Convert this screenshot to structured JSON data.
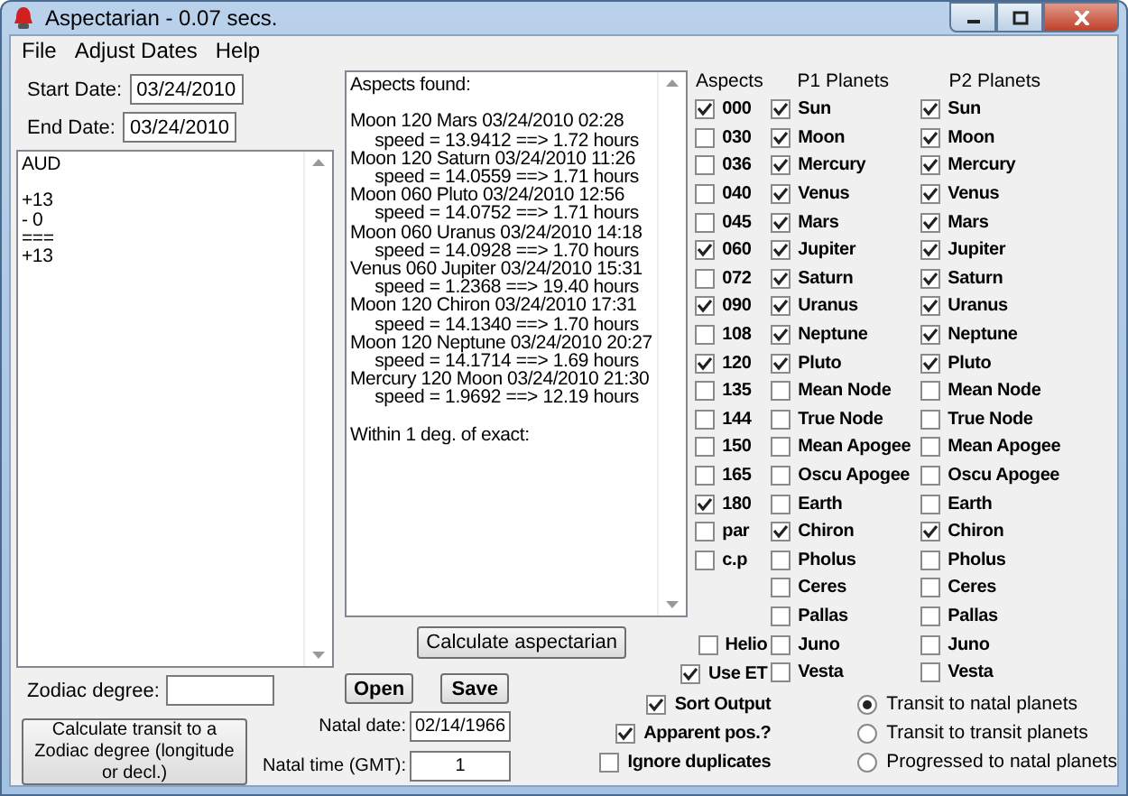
{
  "window": {
    "title": "Aspectarian - 0.07 secs."
  },
  "menu": [
    "File",
    "Adjust Dates",
    "Help"
  ],
  "start_date": {
    "label": "Start Date:",
    "value": "03/24/2010"
  },
  "end_date": {
    "label": "End Date:",
    "value": "03/24/2010"
  },
  "notes": "AUD\n\n+13\n- 0\n===\n+13",
  "zodiac_degree": {
    "label": "Zodiac degree:"
  },
  "zodiac_button": "Calculate transit to a Zodiac degree (longitude or decl.)",
  "output": "Aspects found:\n\nMoon 120 Mars 03/24/2010 02:28\n     speed = 13.9412 ==> 1.72 hours\nMoon 120 Saturn 03/24/2010 11:26\n     speed = 14.0559 ==> 1.71 hours\nMoon 060 Pluto 03/24/2010 12:56\n     speed = 14.0752 ==> 1.71 hours\nMoon 060 Uranus 03/24/2010 14:18\n     speed = 14.0928 ==> 1.70 hours\nVenus 060 Jupiter 03/24/2010 15:31\n     speed = 1.2368 ==> 19.40 hours\nMoon 120 Chiron 03/24/2010 17:31\n     speed = 14.1340 ==> 1.70 hours\nMoon 120 Neptune 03/24/2010 20:27\n     speed = 14.1714 ==> 1.69 hours\nMercury 120 Moon 03/24/2010 21:30\n     speed = 1.9692 ==> 12.19 hours\n\nWithin 1 deg. of exact:",
  "calculate_button": "Calculate aspectarian",
  "open_button": "Open",
  "save_button": "Save",
  "natal_date": {
    "label": "Natal date:",
    "value": "02/14/1966"
  },
  "natal_time": {
    "label": "Natal time (GMT):",
    "value": "1"
  },
  "headers": [
    "Aspects",
    "P1 Planets",
    "P2 Planets"
  ],
  "aspects": [
    {
      "label": "000",
      "checked": true
    },
    {
      "label": "030",
      "checked": false
    },
    {
      "label": "036",
      "checked": false
    },
    {
      "label": "040",
      "checked": false
    },
    {
      "label": "045",
      "checked": false
    },
    {
      "label": "060",
      "checked": true
    },
    {
      "label": "072",
      "checked": false
    },
    {
      "label": "090",
      "checked": true
    },
    {
      "label": "108",
      "checked": false
    },
    {
      "label": "120",
      "checked": true
    },
    {
      "label": "135",
      "checked": false
    },
    {
      "label": "144",
      "checked": false
    },
    {
      "label": "150",
      "checked": false
    },
    {
      "label": "165",
      "checked": false
    },
    {
      "label": "180",
      "checked": true
    },
    {
      "label": "par",
      "checked": false
    },
    {
      "label": "c.p",
      "checked": false
    }
  ],
  "p1_planets": [
    {
      "label": "Sun",
      "checked": true
    },
    {
      "label": "Moon",
      "checked": true
    },
    {
      "label": "Mercury",
      "checked": true
    },
    {
      "label": "Venus",
      "checked": true
    },
    {
      "label": "Mars",
      "checked": true
    },
    {
      "label": "Jupiter",
      "checked": true
    },
    {
      "label": "Saturn",
      "checked": true
    },
    {
      "label": "Uranus",
      "checked": true
    },
    {
      "label": "Neptune",
      "checked": true
    },
    {
      "label": "Pluto",
      "checked": true
    },
    {
      "label": "Mean Node",
      "checked": false
    },
    {
      "label": "True Node",
      "checked": false
    },
    {
      "label": "Mean Apogee",
      "checked": false
    },
    {
      "label": "Oscu Apogee",
      "checked": false
    },
    {
      "label": "Earth",
      "checked": false
    },
    {
      "label": "Chiron",
      "checked": true
    },
    {
      "label": "Pholus",
      "checked": false
    },
    {
      "label": "Ceres",
      "checked": false
    },
    {
      "label": "Pallas",
      "checked": false
    },
    {
      "label": "Juno",
      "checked": false
    },
    {
      "label": "Vesta",
      "checked": false
    }
  ],
  "p2_planets": [
    {
      "label": "Sun",
      "checked": true
    },
    {
      "label": "Moon",
      "checked": true
    },
    {
      "label": "Mercury",
      "checked": true
    },
    {
      "label": "Venus",
      "checked": true
    },
    {
      "label": "Mars",
      "checked": true
    },
    {
      "label": "Jupiter",
      "checked": true
    },
    {
      "label": "Saturn",
      "checked": true
    },
    {
      "label": "Uranus",
      "checked": true
    },
    {
      "label": "Neptune",
      "checked": true
    },
    {
      "label": "Pluto",
      "checked": true
    },
    {
      "label": "Mean Node",
      "checked": false
    },
    {
      "label": "True Node",
      "checked": false
    },
    {
      "label": "Mean Apogee",
      "checked": false
    },
    {
      "label": "Oscu Apogee",
      "checked": false
    },
    {
      "label": "Earth",
      "checked": false
    },
    {
      "label": "Chiron",
      "checked": true
    },
    {
      "label": "Pholus",
      "checked": false
    },
    {
      "label": "Ceres",
      "checked": false
    },
    {
      "label": "Pallas",
      "checked": false
    },
    {
      "label": "Juno",
      "checked": false
    },
    {
      "label": "Vesta",
      "checked": false
    }
  ],
  "side_options": [
    {
      "label": "Helio",
      "checked": false
    },
    {
      "label": "Use ET",
      "checked": true
    }
  ],
  "output_options": [
    {
      "label": "Sort Output",
      "checked": true
    },
    {
      "label": "Apparent pos.?",
      "checked": true
    },
    {
      "label": "Ignore duplicates",
      "checked": false
    }
  ],
  "modes": [
    {
      "label": "Transit to natal planets",
      "selected": true
    },
    {
      "label": "Transit to transit planets",
      "selected": false
    },
    {
      "label": "Progressed to natal planets",
      "selected": false
    }
  ]
}
